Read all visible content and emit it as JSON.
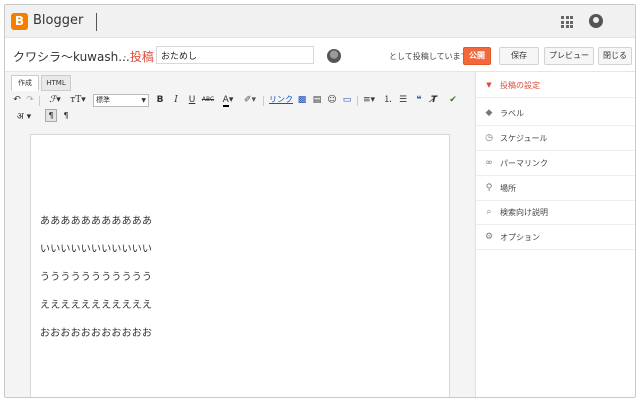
{
  "app": {
    "logo_letter": "B",
    "brand": "Blogger",
    "accent": "#f57d00"
  },
  "header": {
    "blog_name": "クワシラ〜kuwash...",
    "separator": "·",
    "section": "投稿",
    "post_title": "おためし",
    "posting_as": "として投稿しています",
    "publish_label": "公開",
    "save_label": "保存",
    "preview_label": "プレビュー",
    "close_label": "閉じる"
  },
  "editor": {
    "tabs": [
      "作成",
      "HTML"
    ],
    "font_size": "標準",
    "link_label": "リンク",
    "lines": [
      "あああああああああああ",
      "いいいいいいいいいいい",
      "ううううううううううう",
      "えええええええええええ",
      "おおおおおおおおおおお"
    ]
  },
  "sidebar": {
    "items": [
      {
        "label": "投稿の設定",
        "icon": "triangle-down-icon"
      },
      {
        "label": "ラベル",
        "icon": "tag-icon"
      },
      {
        "label": "スケジュール",
        "icon": "clock-icon"
      },
      {
        "label": "パーマリンク",
        "icon": "link-icon"
      },
      {
        "label": "場所",
        "icon": "pin-icon"
      },
      {
        "label": "検索向け説明",
        "icon": "search-icon"
      },
      {
        "label": "オプション",
        "icon": "gear-icon"
      }
    ]
  },
  "colors": {
    "publish": "#f2683a",
    "active_label": "#dd4b39",
    "link": "#1155cc"
  }
}
